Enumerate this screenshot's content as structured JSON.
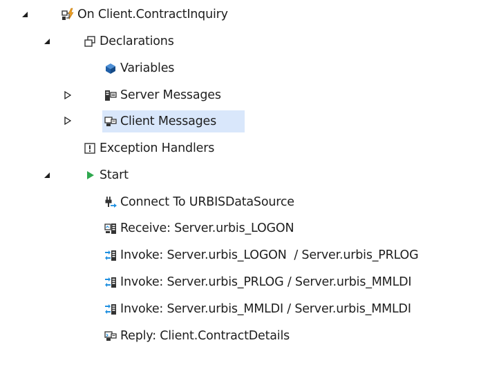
{
  "tree": {
    "root": {
      "label": "On Client.ContractInquiry",
      "icon": "orchestration-icon",
      "expanded": true,
      "children": {
        "declarations": {
          "label": "Declarations",
          "icon": "declarations-icon",
          "expanded": true,
          "children": {
            "variables": {
              "label": "Variables",
              "icon": "variables-icon"
            },
            "server_messages": {
              "label": "Server Messages",
              "icon": "server-messages-icon",
              "expanded": false
            },
            "client_messages": {
              "label": "Client Messages",
              "icon": "client-messages-icon",
              "expanded": false,
              "selected": true
            }
          }
        },
        "exception_handlers": {
          "label": "Exception Handlers",
          "icon": "exception-icon"
        },
        "start": {
          "label": "Start",
          "icon": "start-icon",
          "expanded": true,
          "children": [
            {
              "label": "Connect To URBISDataSource",
              "icon": "connect-icon"
            },
            {
              "label": "Receive: Server.urbis_LOGON",
              "icon": "receive-icon"
            },
            {
              "label": "Invoke: Server.urbis_LOGON  / Server.urbis_PRLOG",
              "icon": "invoke-icon"
            },
            {
              "label": "Invoke: Server.urbis_PRLOG / Server.urbis_MMLDI",
              "icon": "invoke-icon"
            },
            {
              "label": "Invoke: Server.urbis_MMLDI / Server.urbis_MMLDI",
              "icon": "invoke-icon"
            },
            {
              "label": "Reply: Client.ContractDetails",
              "icon": "reply-icon"
            }
          ]
        }
      }
    }
  },
  "colors": {
    "selection": "#d9e7fb",
    "start_arrow": "#2fa84f",
    "variables_cube": "#1f5fa8",
    "invoke_arrow": "#1e8fe0",
    "orchestration_accent": "#f0a020"
  }
}
